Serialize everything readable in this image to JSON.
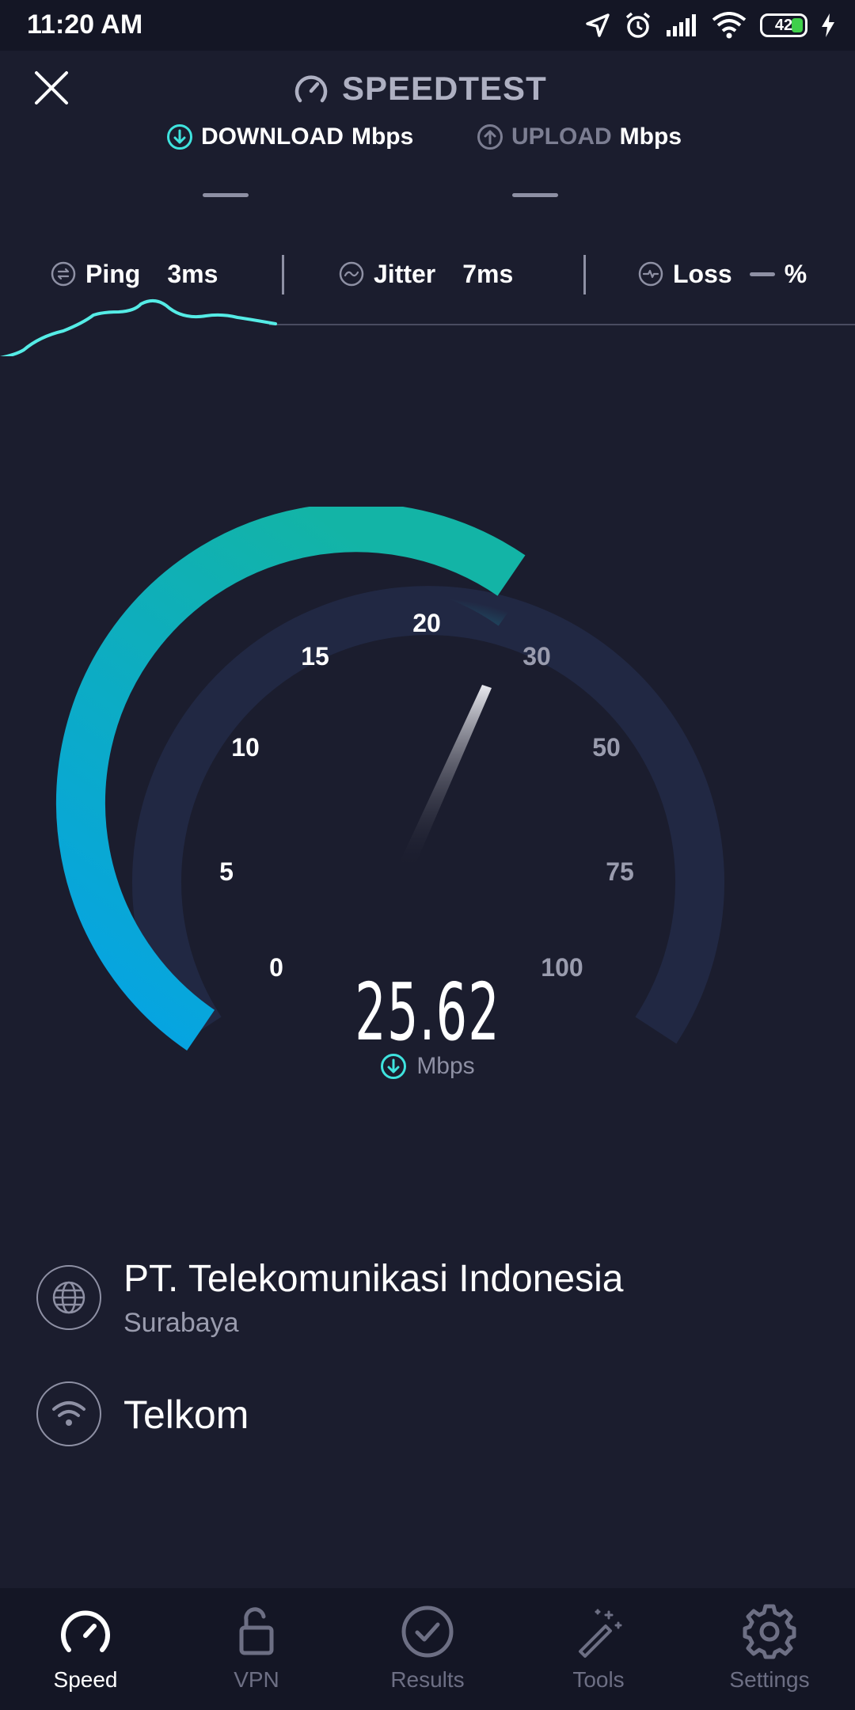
{
  "status_bar": {
    "time": "11:20 AM",
    "battery": "42"
  },
  "header": {
    "title": "SPEEDTEST"
  },
  "tabs": {
    "download_label": "DOWNLOAD",
    "download_unit": "Mbps",
    "upload_label": "UPLOAD",
    "upload_unit": "Mbps"
  },
  "metrics": {
    "ping_label": "Ping",
    "ping_value": "3ms",
    "jitter_label": "Jitter",
    "jitter_value": "7ms",
    "loss_label": "Loss",
    "loss_unit": "%"
  },
  "gauge": {
    "ticks": [
      "0",
      "5",
      "10",
      "15",
      "20",
      "30",
      "50",
      "75",
      "100"
    ],
    "current_value": "25.62",
    "unit": "Mbps",
    "accent": "#12b2a8",
    "accent_start": "#0aa0e6"
  },
  "provider": {
    "isp": "PT. Telekomunikasi Indonesia",
    "city": "Surabaya",
    "network": "Telkom"
  },
  "nav": [
    {
      "label": "Speed",
      "icon": "speedometer-icon",
      "active": true
    },
    {
      "label": "VPN",
      "icon": "lock-icon",
      "active": false
    },
    {
      "label": "Results",
      "icon": "check-circle-icon",
      "active": false
    },
    {
      "label": "Tools",
      "icon": "magic-wand-icon",
      "active": false
    },
    {
      "label": "Settings",
      "icon": "gear-icon",
      "active": false
    }
  ]
}
